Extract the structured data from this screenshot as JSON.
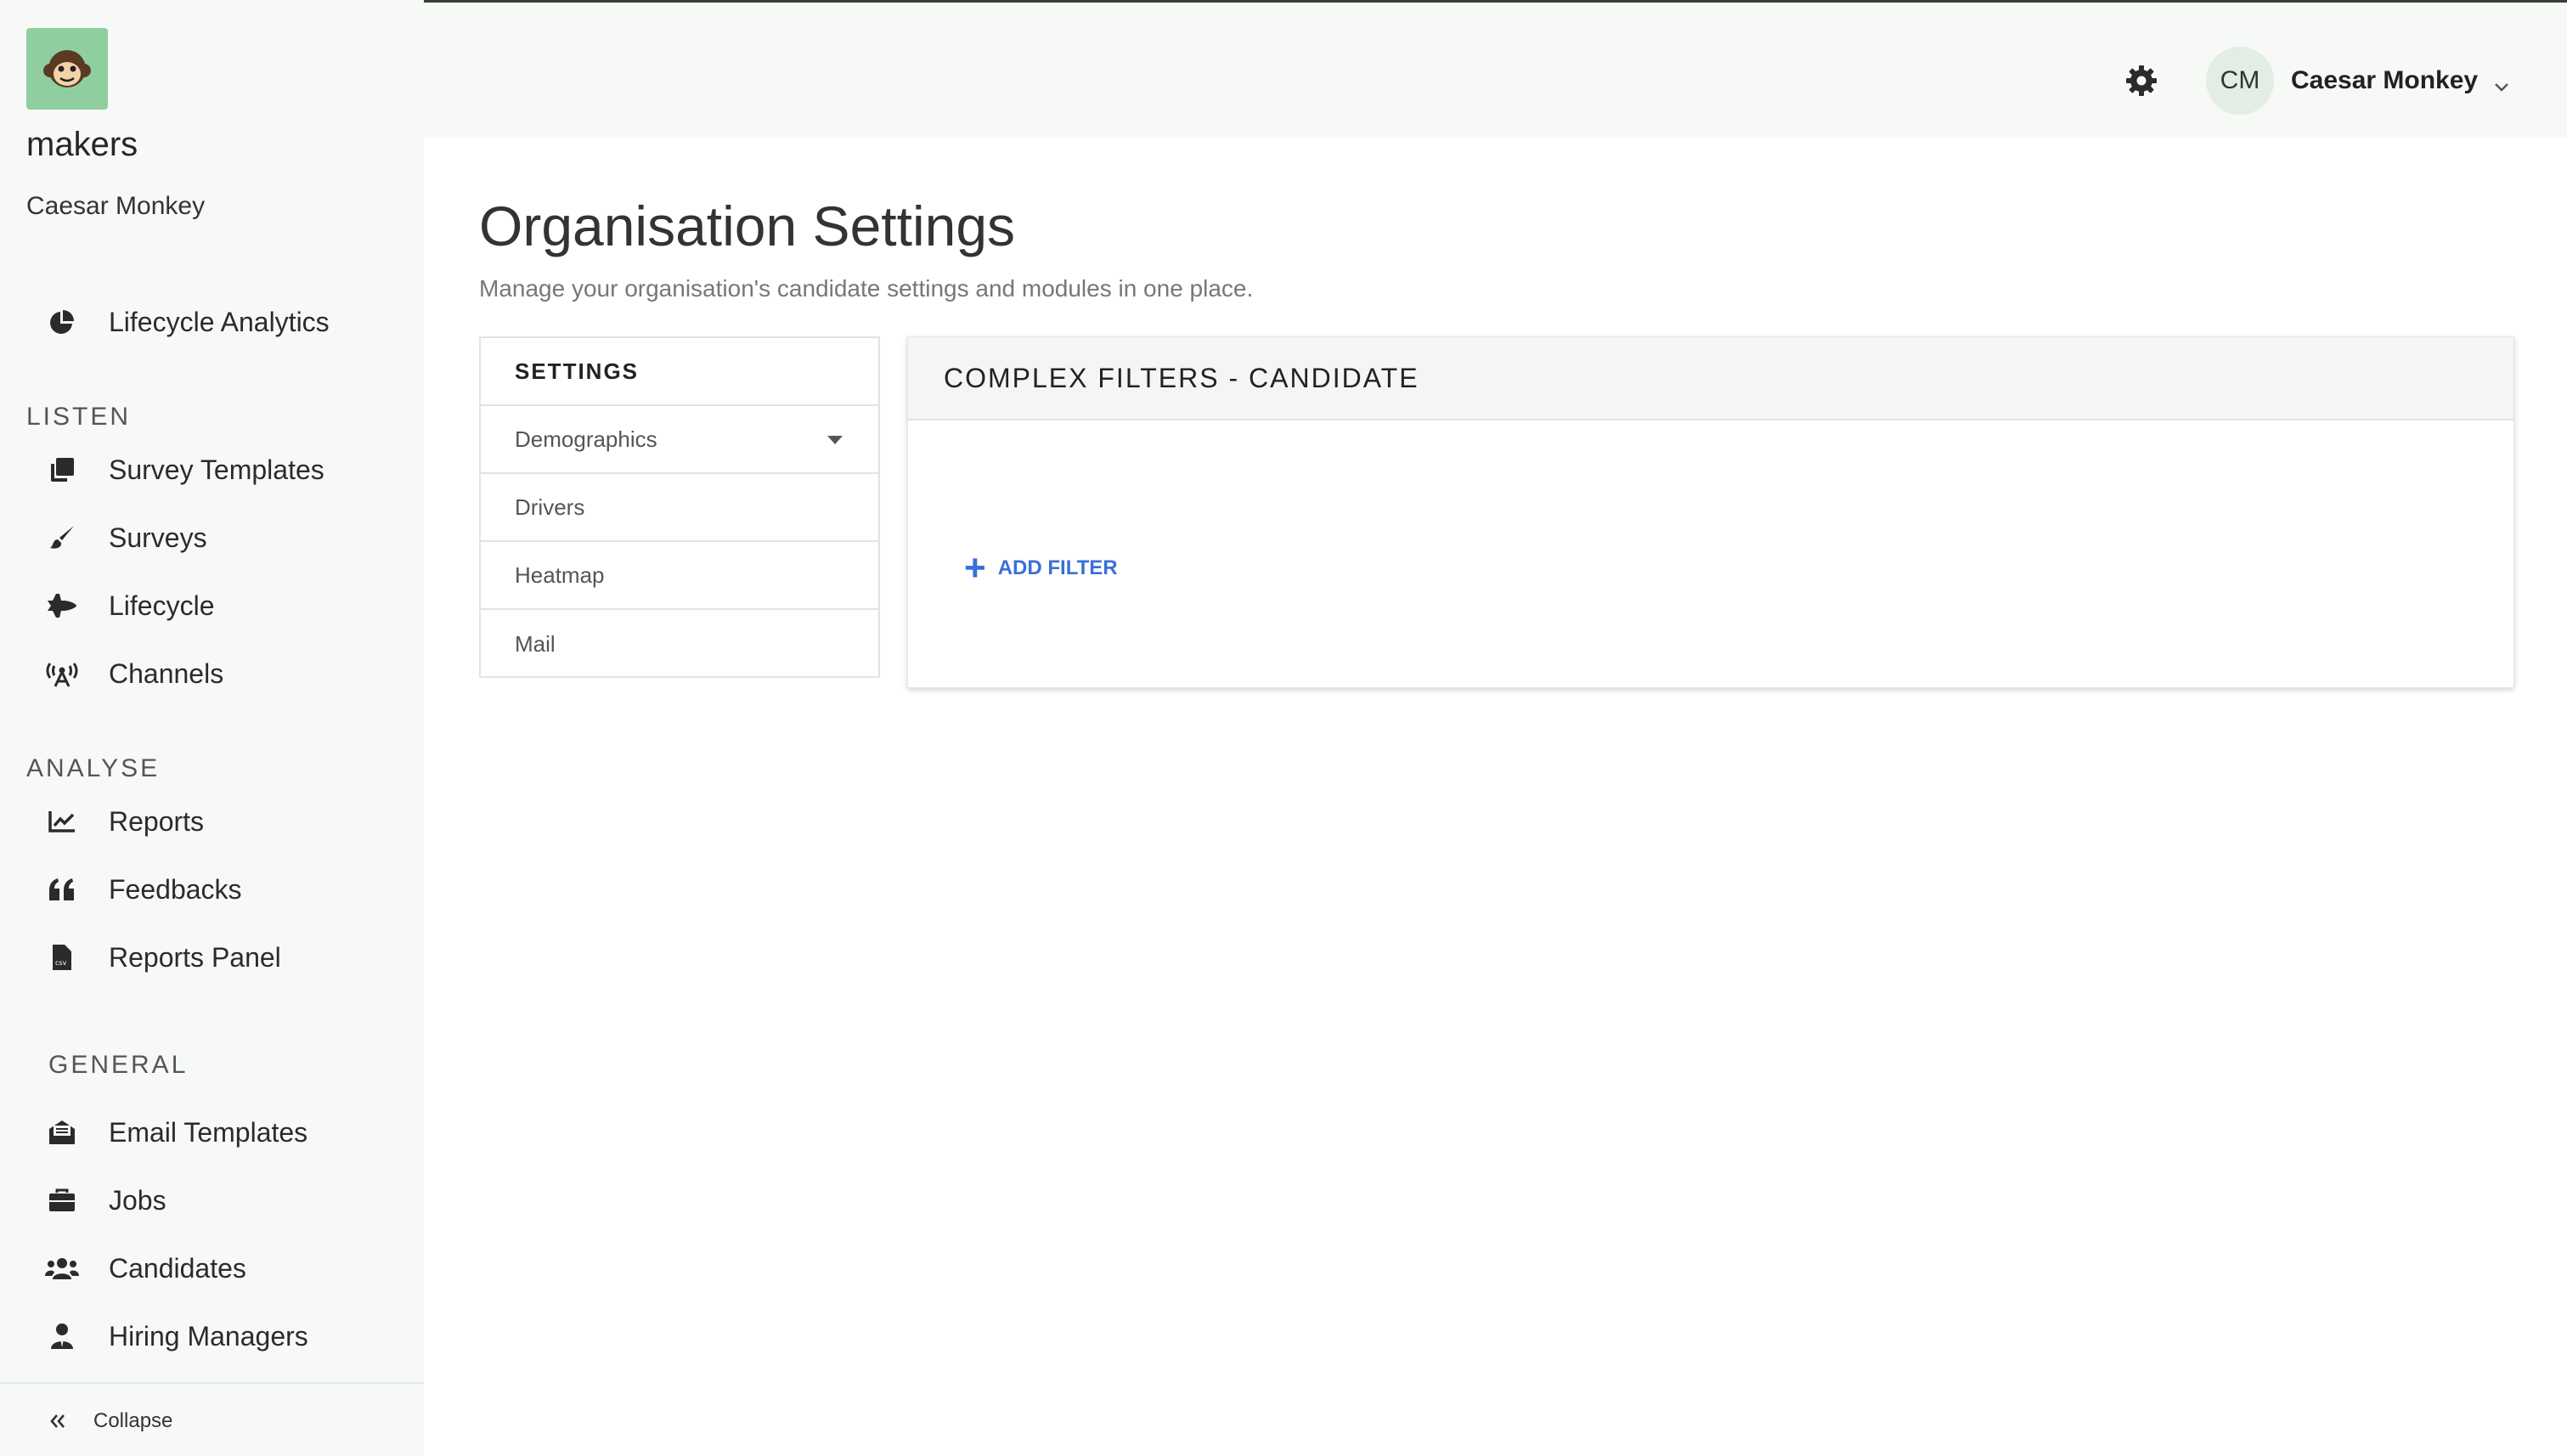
{
  "sidebar": {
    "org_name": "makers",
    "user": "Caesar Monkey",
    "top_item": "Lifecycle Analytics",
    "sections": {
      "listen": "LISTEN",
      "analyse": "ANALYSE",
      "general": "GENERAL"
    },
    "listen_items": [
      "Survey Templates",
      "Surveys",
      "Lifecycle",
      "Channels"
    ],
    "analyse_items": [
      "Reports",
      "Feedbacks",
      "Reports Panel"
    ],
    "general_items": [
      "Email Templates",
      "Jobs",
      "Candidates",
      "Hiring Managers"
    ],
    "collapse": "Collapse"
  },
  "header": {
    "avatar_initials": "CM",
    "user_name": "Caesar Monkey"
  },
  "page": {
    "title": "Organisation Settings",
    "subtitle": "Manage your organisation's candidate settings and modules in one place."
  },
  "settings_panel": {
    "heading": "SETTINGS",
    "items": [
      "Demographics",
      "Drivers",
      "Heatmap",
      "Mail"
    ]
  },
  "filters_card": {
    "heading": "COMPLEX FILTERS - CANDIDATE",
    "add_filter": "ADD FILTER"
  },
  "colors": {
    "accent": "#3b6fd8",
    "logo_bg": "#8fcf9f",
    "sidebar_bg": "#f6f9f6"
  },
  "icons": {
    "lifecycle_analytics": "pie-chart-icon",
    "survey_templates": "copy-icon",
    "surveys": "brush-icon",
    "lifecycle": "space-shuttle-icon",
    "channels": "broadcast-tower-icon",
    "reports": "line-chart-icon",
    "feedbacks": "quote-icon",
    "reports_panel": "csv-file-icon",
    "email_templates": "envelope-open-icon",
    "jobs": "briefcase-icon",
    "candidates": "users-icon",
    "hiring_managers": "user-tie-icon",
    "collapse": "double-chevron-left-icon",
    "settings": "gear-icon",
    "user_menu": "chevron-down-icon"
  }
}
